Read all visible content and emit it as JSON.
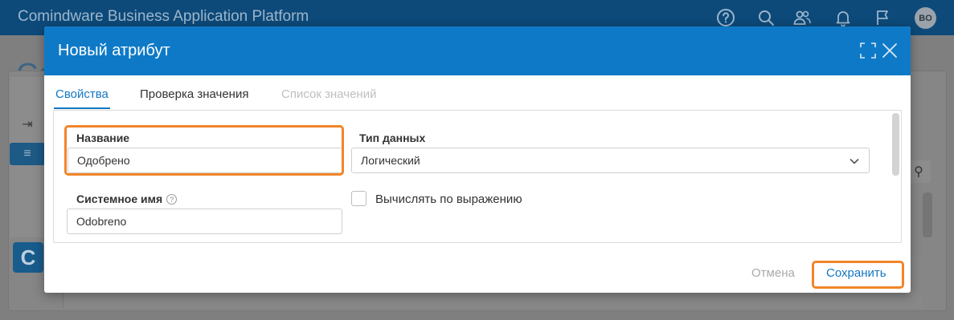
{
  "app": {
    "title": "Comindware Business Application Platform",
    "page_title_partial": "Co",
    "user_initials": "BO",
    "logo_letter": "C",
    "header_icons": [
      "help-icon",
      "search-icon",
      "users-icon",
      "bell-icon",
      "flag-icon"
    ]
  },
  "dialog": {
    "title": "Новый атрибут",
    "tabs": [
      {
        "label": "Свойства",
        "state": "active"
      },
      {
        "label": "Проверка значения",
        "state": "normal"
      },
      {
        "label": "Список значений",
        "state": "disabled"
      }
    ],
    "fields": {
      "name": {
        "label": "Название",
        "value": "Одобрено"
      },
      "data_type": {
        "label": "Тип данных",
        "value": "Логический"
      },
      "system_name": {
        "label": "Системное имя",
        "value": "Odobreno",
        "help": "?"
      },
      "calculate": {
        "label": "Вычислять по выражению",
        "checked": false
      }
    },
    "buttons": {
      "cancel": "Отмена",
      "save": "Сохранить"
    }
  },
  "colors": {
    "app_header": "#0d4a7a",
    "dialog_header": "#0e7ac7",
    "accent": "#1377c1",
    "highlight": "#f2852a"
  }
}
